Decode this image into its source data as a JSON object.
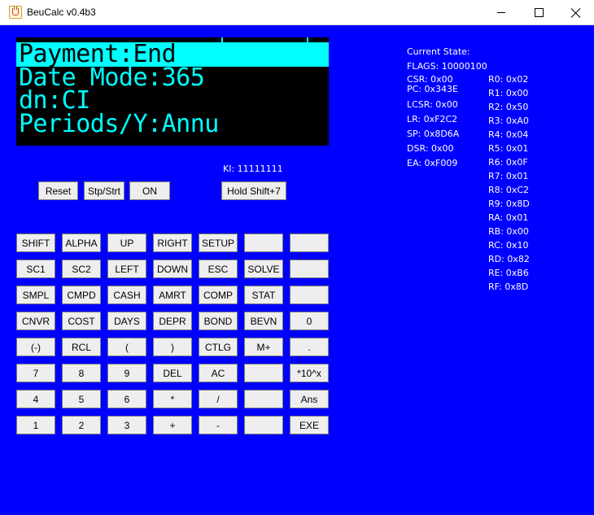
{
  "window": {
    "title": "BeuCalc v0.4b3"
  },
  "lcd": {
    "lines": [
      "Payment:End",
      "Date Mode:365",
      "dn:CI",
      "Periods/Y:Annu"
    ]
  },
  "ki": "KI: 11111111",
  "top_buttons": [
    "Reset",
    "Stp/Strt",
    "ON",
    "Hold Shift+7"
  ],
  "keypad": {
    "rows": [
      [
        "SHIFT",
        "ALPHA",
        "UP",
        "RIGHT",
        "SETUP",
        "",
        ""
      ],
      [
        "SC1",
        "SC2",
        "LEFT",
        "DOWN",
        "ESC",
        "SOLVE",
        ""
      ],
      [
        "SMPL",
        "CMPD",
        "CASH",
        "AMRT",
        "COMP",
        "STAT",
        ""
      ],
      [
        "CNVR",
        "COST",
        "DAYS",
        "DEPR",
        "BOND",
        "BEVN",
        "0"
      ],
      [
        "(-)",
        "RCL",
        "(",
        ")",
        "CTLG",
        "M+",
        "."
      ],
      [
        "7",
        "8",
        "9",
        "DEL",
        "AC",
        "",
        "*10^x"
      ],
      [
        "4",
        "5",
        "6",
        "*",
        "/",
        "",
        "Ans"
      ],
      [
        "1",
        "2",
        "3",
        "+",
        "-",
        "",
        "EXE"
      ]
    ]
  },
  "state": {
    "heading": "Current State:",
    "flags": "FLAGS: 10000100",
    "left": [
      "CSR: 0x00",
      "PC: 0x343E",
      "LCSR: 0x00",
      "LR: 0xF2C2",
      "SP: 0x8D6A",
      "DSR: 0x00",
      "EA: 0xF009"
    ],
    "registers": [
      "R0: 0x02",
      "R1: 0x00",
      "R2: 0x50",
      "R3: 0xA0",
      "R4: 0x04",
      "R5: 0x01",
      "R6: 0x0F",
      "R7: 0x01",
      "R8: 0xC2",
      "R9: 0x8D",
      "RA: 0x01",
      "RB: 0x00",
      "RC: 0x10",
      "RD: 0x82",
      "RE: 0xB6",
      "RF: 0x8D"
    ]
  }
}
